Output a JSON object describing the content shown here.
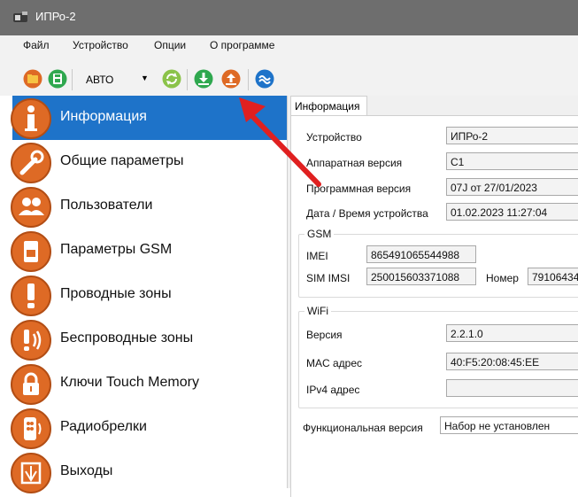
{
  "window": {
    "title": "ИПРо-2"
  },
  "menu": {
    "items": [
      "Файл",
      "Устройство",
      "Опции",
      "О программе"
    ]
  },
  "toolbar": {
    "mode_value": "АВТО"
  },
  "sidebar": {
    "items": [
      {
        "label": "Информация",
        "icon": "info-icon",
        "active": true
      },
      {
        "label": "Общие параметры",
        "icon": "wrench-icon"
      },
      {
        "label": "Пользователи",
        "icon": "users-icon"
      },
      {
        "label": "Параметры GSM",
        "icon": "sim-card-icon"
      },
      {
        "label": "Проводные зоны",
        "icon": "exclamation-icon"
      },
      {
        "label": "Беспроводные зоны",
        "icon": "wireless-exclamation-icon"
      },
      {
        "label": "Ключи Touch Memory",
        "icon": "lock-icon"
      },
      {
        "label": "Радиобрелки",
        "icon": "keyfob-icon"
      },
      {
        "label": "Выходы",
        "icon": "output-icon"
      }
    ]
  },
  "tabs": {
    "info": "Информация"
  },
  "info": {
    "device_label": "Устройство",
    "device_value": "ИПРо-2",
    "hw_label": "Аппаратная версия",
    "hw_value": "C1",
    "fw_label": "Программная версия",
    "fw_value": "07J от 27/01/2023",
    "datetime_label": "Дата / Время устройства",
    "datetime_value": "01.02.2023 11:27:04"
  },
  "gsm": {
    "legend": "GSM",
    "imei_label": "IMEI",
    "imei_value": "865491065544988",
    "imsi_label": "SIM IMSI",
    "imsi_value": "250015603371088",
    "number_label": "Номер",
    "number_value": "79106434"
  },
  "wifi": {
    "legend": "WiFi",
    "version_label": "Версия",
    "version_value": "2.2.1.0",
    "mac_label": "MAC адрес",
    "mac_value": "40:F5:20:08:45:EE",
    "ipv4_label": "IPv4 адрес",
    "ipv4_value": ""
  },
  "functional": {
    "label": "Функциональная версия",
    "value": "Набор не установлен"
  },
  "colors": {
    "accent": "#1e73c9",
    "icon_orange": "#de6a25",
    "green": "#2fa84f",
    "arrow_red": "#e02020"
  }
}
